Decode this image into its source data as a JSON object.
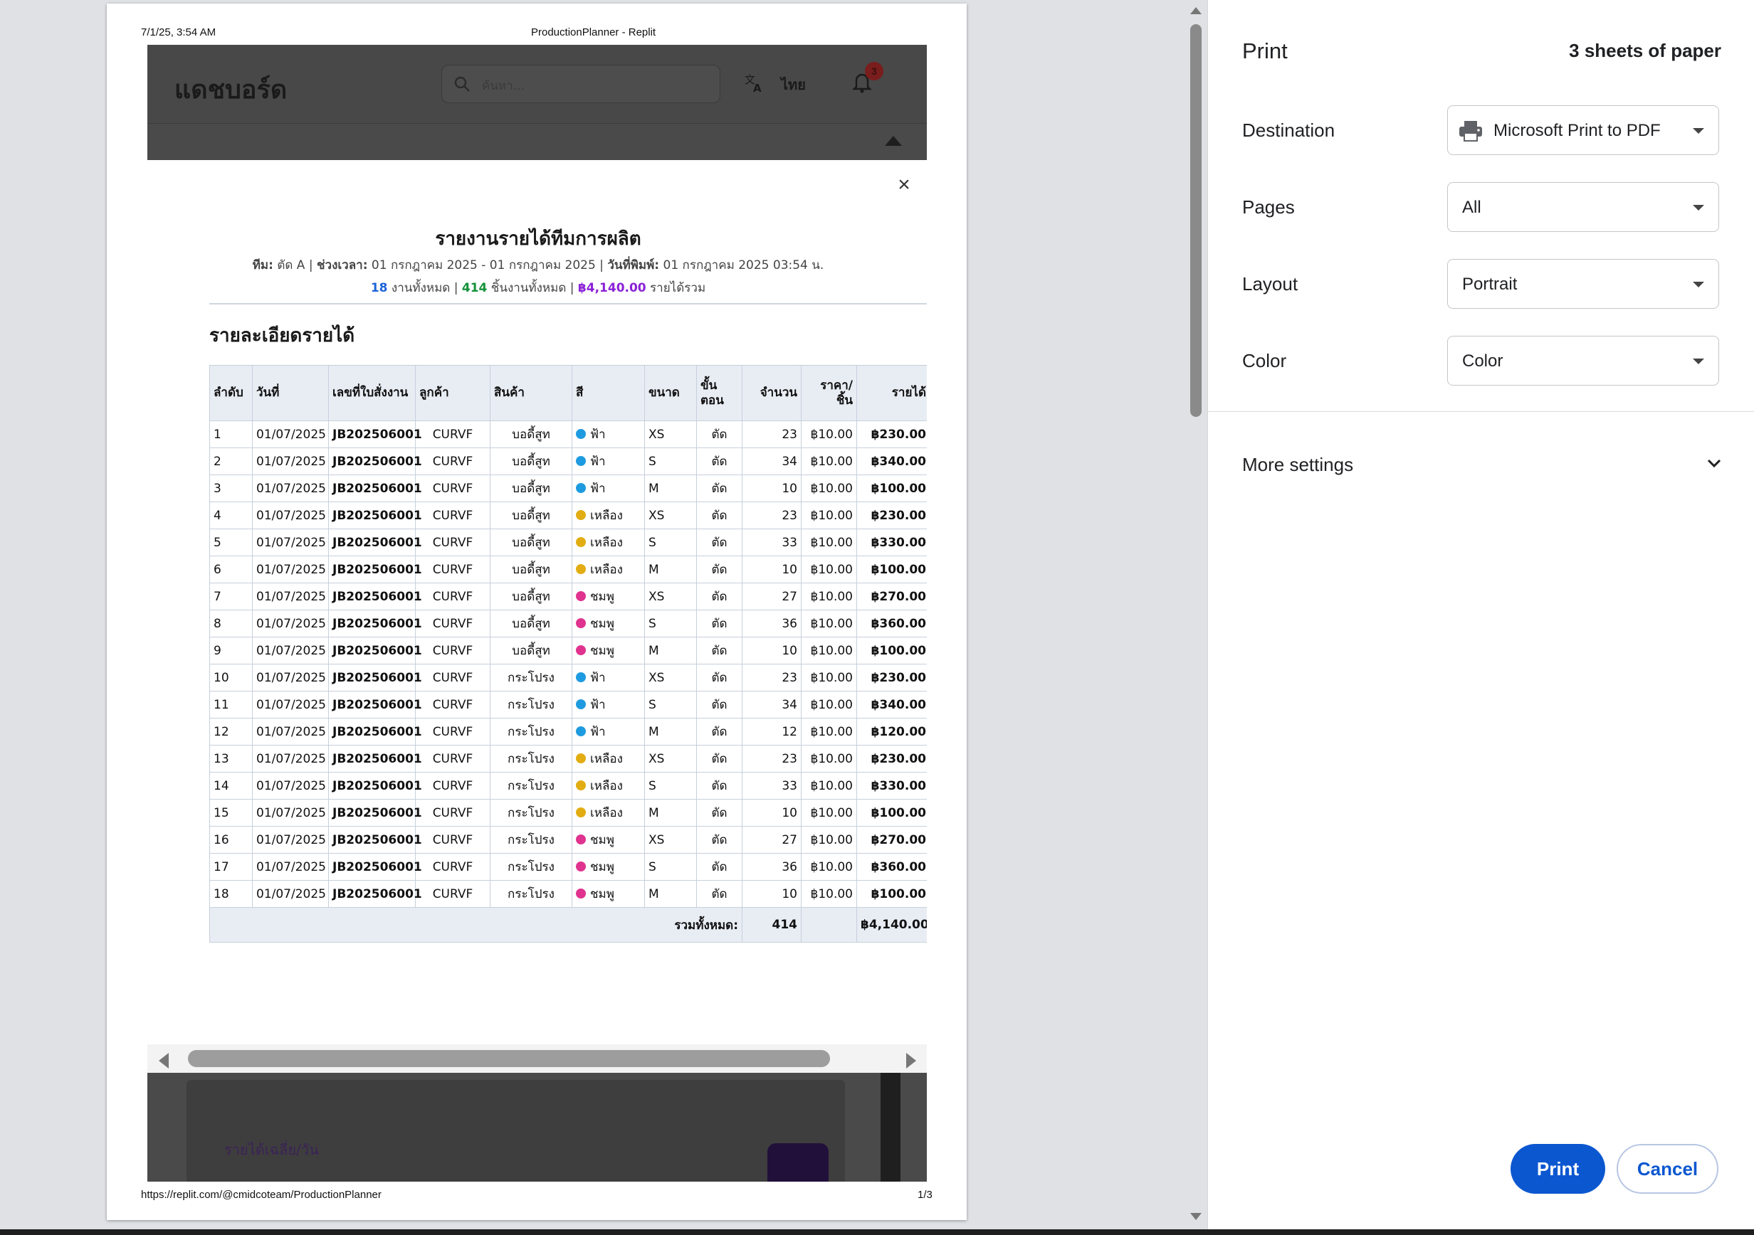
{
  "preview": {
    "header_date": "7/1/25, 3:54 AM",
    "header_title": "ProductionPlanner - Replit",
    "footer_url": "https://replit.com/@cmidcoteam/ProductionPlanner",
    "footer_page": "1/3"
  },
  "app": {
    "title": "แดชบอร์ด",
    "search_placeholder": "ค้นหา...",
    "language": "ไทย",
    "notification_count": "3",
    "avg_label": "รายได้เฉลี่ย/วัน"
  },
  "modal": {
    "close_symbol": "×",
    "report_title": "รายงานรายได้ทีมการผลิต",
    "meta": {
      "team_label": "ทีม:",
      "team_value": "ตัด A",
      "period_label": "ช่วงเวลา:",
      "period_value": "01 กรกฎาคม 2025 - 01 กรกฎาคม 2025",
      "printed_label": "วันที่พิมพ์:",
      "printed_value": "01 กรกฎาคม 2025 03:54 น."
    },
    "summary": {
      "jobs_count": "18",
      "jobs_label": "งานทั้งหมด",
      "pieces_count": "414",
      "pieces_label": "ชิ้นงานทั้งหมด",
      "revenue_total": "฿4,140.00",
      "revenue_label": "รายได้รวม"
    },
    "section_title": "รายละเอียดรายได้",
    "table": {
      "headers": [
        "ลำดับ",
        "วันที่",
        "เลขที่ใบสั่งงาน",
        "ลูกค้า",
        "สินค้า",
        "สี",
        "ขนาด",
        "ขั้นตอน",
        "จำนวน",
        "ราคา/ชิ้น",
        "รายได้"
      ],
      "rows": [
        [
          "1",
          "01/07/2025",
          "JB202506001",
          "CURVF",
          "บอดี้สูท",
          "ฟ้า",
          "XS",
          "ตัด",
          "23",
          "฿10.00",
          "฿230.00"
        ],
        [
          "2",
          "01/07/2025",
          "JB202506001",
          "CURVF",
          "บอดี้สูท",
          "ฟ้า",
          "S",
          "ตัด",
          "34",
          "฿10.00",
          "฿340.00"
        ],
        [
          "3",
          "01/07/2025",
          "JB202506001",
          "CURVF",
          "บอดี้สูท",
          "ฟ้า",
          "M",
          "ตัด",
          "10",
          "฿10.00",
          "฿100.00"
        ],
        [
          "4",
          "01/07/2025",
          "JB202506001",
          "CURVF",
          "บอดี้สูท",
          "เหลือง",
          "XS",
          "ตัด",
          "23",
          "฿10.00",
          "฿230.00"
        ],
        [
          "5",
          "01/07/2025",
          "JB202506001",
          "CURVF",
          "บอดี้สูท",
          "เหลือง",
          "S",
          "ตัด",
          "33",
          "฿10.00",
          "฿330.00"
        ],
        [
          "6",
          "01/07/2025",
          "JB202506001",
          "CURVF",
          "บอดี้สูท",
          "เหลือง",
          "M",
          "ตัด",
          "10",
          "฿10.00",
          "฿100.00"
        ],
        [
          "7",
          "01/07/2025",
          "JB202506001",
          "CURVF",
          "บอดี้สูท",
          "ชมพู",
          "XS",
          "ตัด",
          "27",
          "฿10.00",
          "฿270.00"
        ],
        [
          "8",
          "01/07/2025",
          "JB202506001",
          "CURVF",
          "บอดี้สูท",
          "ชมพู",
          "S",
          "ตัด",
          "36",
          "฿10.00",
          "฿360.00"
        ],
        [
          "9",
          "01/07/2025",
          "JB202506001",
          "CURVF",
          "บอดี้สูท",
          "ชมพู",
          "M",
          "ตัด",
          "10",
          "฿10.00",
          "฿100.00"
        ],
        [
          "10",
          "01/07/2025",
          "JB202506001",
          "CURVF",
          "กระโปรง",
          "ฟ้า",
          "XS",
          "ตัด",
          "23",
          "฿10.00",
          "฿230.00"
        ],
        [
          "11",
          "01/07/2025",
          "JB202506001",
          "CURVF",
          "กระโปรง",
          "ฟ้า",
          "S",
          "ตัด",
          "34",
          "฿10.00",
          "฿340.00"
        ],
        [
          "12",
          "01/07/2025",
          "JB202506001",
          "CURVF",
          "กระโปรง",
          "ฟ้า",
          "M",
          "ตัด",
          "12",
          "฿10.00",
          "฿120.00"
        ],
        [
          "13",
          "01/07/2025",
          "JB202506001",
          "CURVF",
          "กระโปรง",
          "เหลือง",
          "XS",
          "ตัด",
          "23",
          "฿10.00",
          "฿230.00"
        ],
        [
          "14",
          "01/07/2025",
          "JB202506001",
          "CURVF",
          "กระโปรง",
          "เหลือง",
          "S",
          "ตัด",
          "33",
          "฿10.00",
          "฿330.00"
        ],
        [
          "15",
          "01/07/2025",
          "JB202506001",
          "CURVF",
          "กระโปรง",
          "เหลือง",
          "M",
          "ตัด",
          "10",
          "฿10.00",
          "฿100.00"
        ],
        [
          "16",
          "01/07/2025",
          "JB202506001",
          "CURVF",
          "กระโปรง",
          "ชมพู",
          "XS",
          "ตัด",
          "27",
          "฿10.00",
          "฿270.00"
        ],
        [
          "17",
          "01/07/2025",
          "JB202506001",
          "CURVF",
          "กระโปรง",
          "ชมพู",
          "S",
          "ตัด",
          "36",
          "฿10.00",
          "฿360.00"
        ],
        [
          "18",
          "01/07/2025",
          "JB202506001",
          "CURVF",
          "กระโปรง",
          "ชมพู",
          "M",
          "ตัด",
          "10",
          "฿10.00",
          "฿100.00"
        ]
      ],
      "total_label": "รวมทั้งหมด:",
      "total_quantity": "414",
      "total_revenue": "฿4,140.00"
    },
    "color_dots": {
      "ฟ้า": "#1e9be0",
      "เหลือง": "#e2ad12",
      "ชมพู": "#e0338f"
    }
  },
  "settings": {
    "title": "Print",
    "sheet_count": "3 sheets of paper",
    "destination_label": "Destination",
    "destination_value": "Microsoft Print to PDF",
    "pages_label": "Pages",
    "pages_value": "All",
    "layout_label": "Layout",
    "layout_value": "Portrait",
    "color_label": "Color",
    "color_value": "Color",
    "more_settings": "More settings",
    "print_button": "Print",
    "cancel_button": "Cancel"
  }
}
